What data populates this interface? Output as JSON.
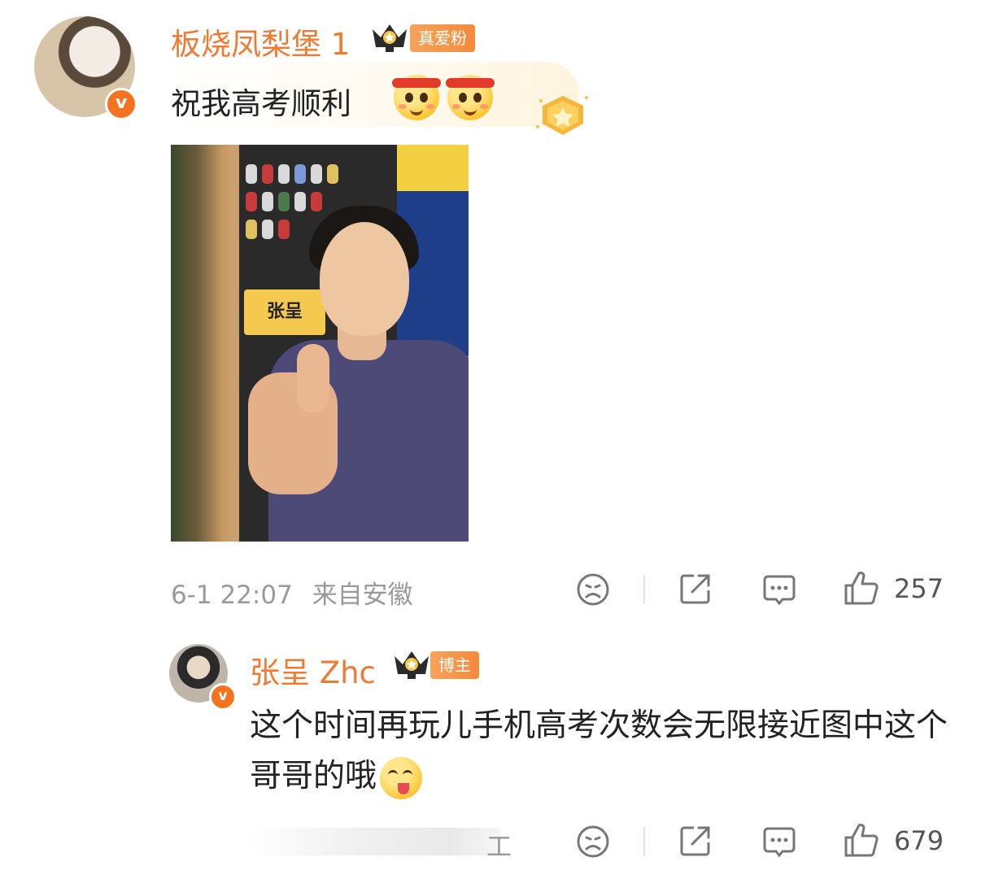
{
  "main_comment": {
    "username": "板烧凤梨堡 1",
    "fan_badge": "真爱粉",
    "text": "祝我高考顺利",
    "timestamp": "6-1 22:07",
    "location": "来自安徽",
    "like_count": "257",
    "photo_label": "张呈",
    "avatar_badge": "v"
  },
  "reply": {
    "username": "张呈 Zhc",
    "fan_badge": "博主",
    "text": "这个时间再玩儿手机高考次数会无限接近图中这个哥哥的哦",
    "like_count": "679",
    "avatar_badge": "v",
    "obscured_char": "工"
  },
  "icons": {
    "dislike": "sad-face-icon",
    "share": "share-icon",
    "comment": "comment-icon",
    "like": "thumbs-up-icon"
  },
  "colors": {
    "username": "#f07a32",
    "badge": "#f58a3b",
    "meta": "#9a9a9a"
  }
}
